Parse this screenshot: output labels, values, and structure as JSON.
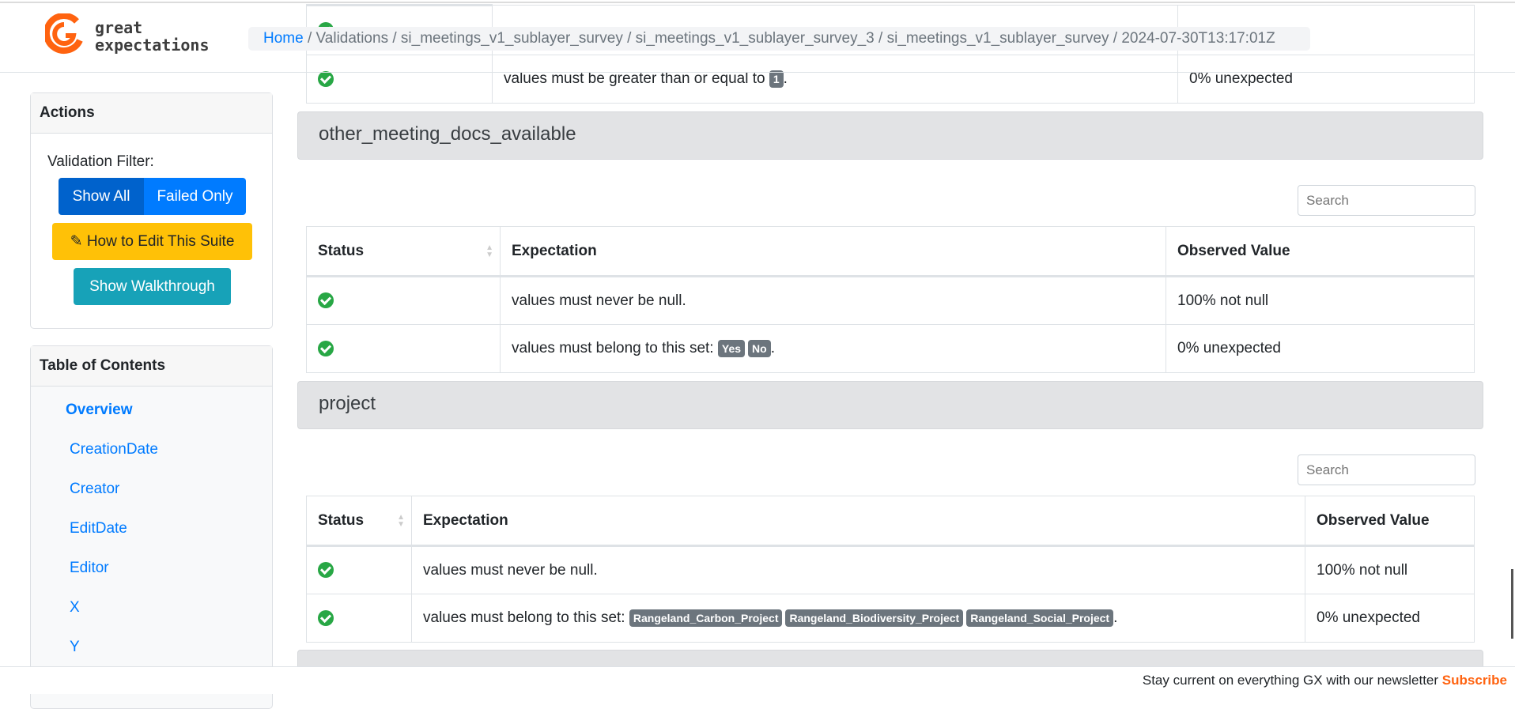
{
  "brand": {
    "name_line1": "great",
    "name_line2": "expectations",
    "color": "#ff6310"
  },
  "breadcrumb": {
    "home": "Home",
    "path": "/ Validations / si_meetings_v1_sublayer_survey / si_meetings_v1_sublayer_survey_3 / si_meetings_v1_sublayer_survey / 2024-07-30T13:17:01Z"
  },
  "actions": {
    "title": "Actions",
    "filter_label": "Validation Filter:",
    "show_all": "Show All",
    "failed_only": "Failed Only",
    "edit_suite": "How to Edit This Suite",
    "walkthrough": "Show Walkthrough"
  },
  "toc": {
    "title": "Table of Contents",
    "items": [
      "Overview",
      "CreationDate",
      "Creator",
      "EditDate",
      "Editor",
      "X",
      "Y"
    ]
  },
  "top_table": {
    "row": {
      "expectation_prefix": "values must be greater than or equal to",
      "badge": "1",
      "observed": "0% unexpected"
    }
  },
  "sections": [
    {
      "title": "other_meeting_docs_available",
      "search_placeholder": "Search",
      "headers": [
        "Status",
        "Expectation",
        "Observed Value"
      ],
      "rows": [
        {
          "status": "success",
          "expectation": "values must never be null.",
          "observed": "100% not null"
        },
        {
          "status": "success",
          "expectation": "values must belong to this set:",
          "badges": [
            "Yes",
            "No"
          ],
          "observed": "0% unexpected"
        }
      ]
    },
    {
      "title": "project",
      "search_placeholder": "Search",
      "headers": [
        "Status",
        "Expectation",
        "Observed Value"
      ],
      "rows": [
        {
          "status": "success",
          "expectation": "values must never be null.",
          "observed": "100% not null"
        },
        {
          "status": "success",
          "expectation": "values must belong to this set:",
          "badges": [
            "Rangeland_Carbon_Project",
            "Rangeland_Biodiversity_Project",
            "Rangeland_Social_Project"
          ],
          "observed": "0% unexpected"
        }
      ]
    }
  ],
  "footer": {
    "text": "Stay current on everything GX with our newsletter",
    "link": "Subscribe"
  }
}
